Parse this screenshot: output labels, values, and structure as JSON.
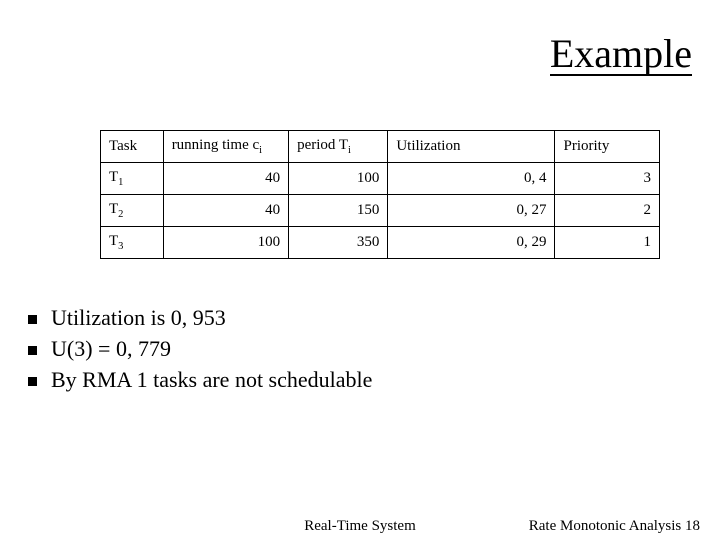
{
  "title": "Example",
  "table": {
    "headers": {
      "task": "Task",
      "running_pre": "running time c",
      "running_sub": "i",
      "period_pre": "period T",
      "period_sub": "i",
      "utilization": "Utilization",
      "priority": "Priority"
    },
    "rows": [
      {
        "task_pre": "T",
        "task_sub": "1",
        "running": "40",
        "period": "100",
        "util": "0, 4",
        "priority": "3"
      },
      {
        "task_pre": "T",
        "task_sub": "2",
        "running": "40",
        "period": "150",
        "util": "0, 27",
        "priority": "2"
      },
      {
        "task_pre": "T",
        "task_sub": "3",
        "running": "100",
        "period": "350",
        "util": "0, 29",
        "priority": "1"
      }
    ]
  },
  "bullets": [
    "Utilization is 0, 953",
    "U(3) = 0, 779",
    "By RMA 1 tasks are not schedulable"
  ],
  "footer": {
    "center": "Real-Time System",
    "right_label": "Rate Monotonic Analysis",
    "page_no": "18"
  }
}
